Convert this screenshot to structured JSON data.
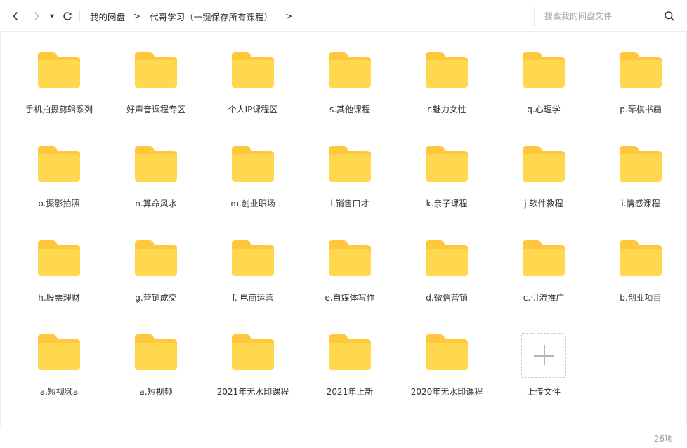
{
  "nav": {
    "back_icon": "chevron-left-icon",
    "forward_icon": "chevron-right-icon",
    "dropdown_icon": "caret-down-icon",
    "refresh_icon": "refresh-icon"
  },
  "breadcrumb": {
    "root": "我的网盘",
    "current": "代哥学习（一键保存所有课程）",
    "separator": ">"
  },
  "search": {
    "placeholder": "搜索我的网盘文件",
    "icon": "search-icon"
  },
  "colors": {
    "folder_body": "#FFD84F",
    "folder_tab": "#FFC73B",
    "border": "#ECECEC"
  },
  "files": [
    {
      "name": "手机拍摄剪辑系列"
    },
    {
      "name": "好声音课程专区"
    },
    {
      "name": "个人IP课程区"
    },
    {
      "name": "s.其他课程"
    },
    {
      "name": "r.魅力女性"
    },
    {
      "name": "q.心理学"
    },
    {
      "name": "p.琴棋书画"
    },
    {
      "name": "o.摄影拍照"
    },
    {
      "name": "n.算命风水"
    },
    {
      "name": "m.创业职场"
    },
    {
      "name": "l.销售口才"
    },
    {
      "name": "k.亲子课程"
    },
    {
      "name": "j.软件教程"
    },
    {
      "name": "i.情感课程"
    },
    {
      "name": "h.股票理财"
    },
    {
      "name": "g.营销成交"
    },
    {
      "name": "f. 电商运营"
    },
    {
      "name": "e.自媒体写作"
    },
    {
      "name": "d.微信营销"
    },
    {
      "name": "c.引流推广"
    },
    {
      "name": "b.创业项目"
    },
    {
      "name": "a.短视频a"
    },
    {
      "name": "a.短视频"
    },
    {
      "name": "2021年无水印课程"
    },
    {
      "name": "2021年上新"
    },
    {
      "name": "2020年无水印课程"
    }
  ],
  "upload": {
    "label": "上传文件",
    "icon": "plus-icon"
  },
  "footer": {
    "count": "26项"
  }
}
